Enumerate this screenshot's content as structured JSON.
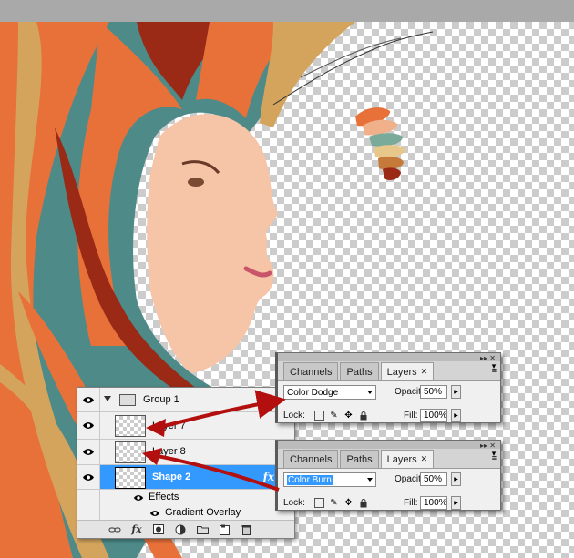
{
  "layers_panel": {
    "rows": [
      {
        "name": "Group 1"
      },
      {
        "name": "Layer 7"
      },
      {
        "name": "Layer 8"
      },
      {
        "name": "Shape 2",
        "fx": "fx"
      },
      {
        "name": "Effects"
      },
      {
        "name": "Gradient Overlay"
      }
    ],
    "bottom_icons": [
      "link-icon",
      "fx-icon",
      "mask-icon",
      "adjustment-icon",
      "folder-icon",
      "new-layer-icon",
      "trash-icon"
    ],
    "fx_label": "fx"
  },
  "panel_top": {
    "tabs": [
      "Channels",
      "Paths",
      "Layers"
    ],
    "blend_mode": "Color Dodge",
    "opacity_label": "Opacity:",
    "opacity_value": "50%",
    "lock_label": "Lock:",
    "fill_label": "Fill:",
    "fill_value": "100%"
  },
  "panel_bottom": {
    "tabs": [
      "Channels",
      "Paths",
      "Layers"
    ],
    "blend_mode": "Color Burn",
    "opacity_label": "Opacity:",
    "opacity_value": "50%",
    "lock_label": "Lock:",
    "fill_label": "Fill:",
    "fill_value": "100%"
  },
  "colors": {
    "selection": "#3399ff",
    "arrow": "#b30f0f",
    "hair_orange": "#e8713a",
    "hair_teal": "#4d8a88",
    "hair_tan": "#d4a45d",
    "hair_red": "#9a2a16"
  },
  "swatch_stack": [
    "#e8713a",
    "#f0b08a",
    "#7aaa9a",
    "#e8c88a",
    "#c57a3a",
    "#9a2a16"
  ]
}
